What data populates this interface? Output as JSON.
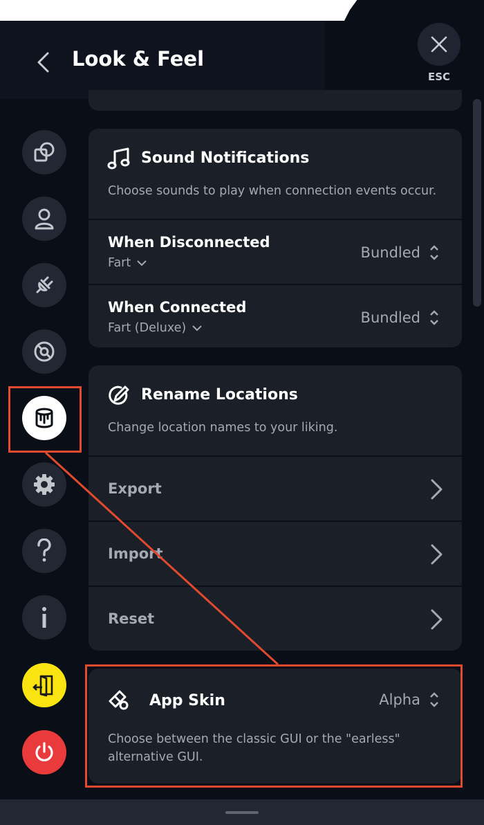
{
  "header": {
    "title": "Look & Feel",
    "esc_label": "ESC"
  },
  "sidebar": {
    "items": [
      {
        "icon": "shapes-icon"
      },
      {
        "icon": "user-icon"
      },
      {
        "icon": "plug-icon"
      },
      {
        "icon": "lifebuoy-icon"
      },
      {
        "icon": "paint-bucket-icon",
        "active": true
      },
      {
        "icon": "gear-icon"
      },
      {
        "icon": "question-icon"
      },
      {
        "icon": "info-icon"
      },
      {
        "icon": "logout-icon"
      },
      {
        "icon": "power-icon"
      }
    ]
  },
  "sound_notifications": {
    "title": "Sound Notifications",
    "description": "Choose sounds to play when connection events occur.",
    "rows": [
      {
        "title": "When Disconnected",
        "sound": "Fart",
        "source": "Bundled"
      },
      {
        "title": "When Connected",
        "sound": "Fart (Deluxe)",
        "source": "Bundled"
      }
    ]
  },
  "rename_locations": {
    "title": "Rename Locations",
    "description": "Change location names to your liking.",
    "actions": [
      "Export",
      "Import",
      "Reset"
    ]
  },
  "app_skin": {
    "title": "App Skin",
    "value": "Alpha",
    "description_line1": "Choose between the classic GUI or the \"earless\"",
    "description_line2": "alternative GUI."
  },
  "colors": {
    "annotation": "#e24a30",
    "background": "#0a0e17",
    "card": "#1b1f27",
    "logout_yellow": "#f9e412",
    "power_red": "#e93b3b"
  }
}
